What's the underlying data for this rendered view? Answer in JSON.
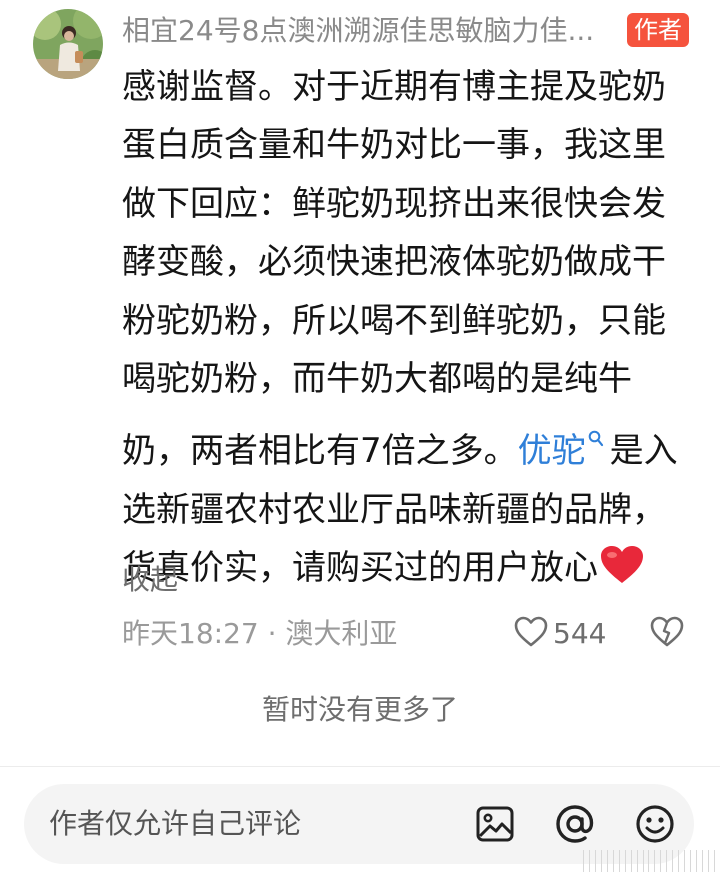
{
  "comment": {
    "username": "相宜24号8点澳洲溯源佳思敏脑力佳...",
    "author_badge": "作者",
    "content": {
      "line1": "感谢监督。对于近期有博主提及驼奶",
      "line2": "蛋白质含量和牛奶对比一事，我这里",
      "line3": "做下回应：鲜驼奶现挤出来很快会发",
      "line4": "酵变酸，必须快速把液体驼奶做成干",
      "line5": "粉驼奶粉，所以喝不到鲜驼奶，只能",
      "line6": "喝驼奶粉，而牛奶大都喝的是纯牛",
      "line7_before": "奶，两者相比有7倍之多。",
      "line7_link": "优驼",
      "line7_after": "是入",
      "line8": "选新疆农村农业厅品味新疆的品牌，",
      "line9": "货真价实，请购买过的用户放心"
    },
    "collapse_label": "收起",
    "timestamp": "昨天18:27",
    "separator": "·",
    "location": "澳大利亚",
    "like_count": "544"
  },
  "footer": {
    "no_more_text": "暂时没有更多了"
  },
  "input_bar": {
    "placeholder": "作者仅允许自己评论",
    "icons": [
      "image-icon",
      "at-icon",
      "emoji-icon"
    ]
  },
  "colors": {
    "author_badge_bg": "#f5533d",
    "link": "#2f7fd8",
    "heart": "#e8283a"
  }
}
